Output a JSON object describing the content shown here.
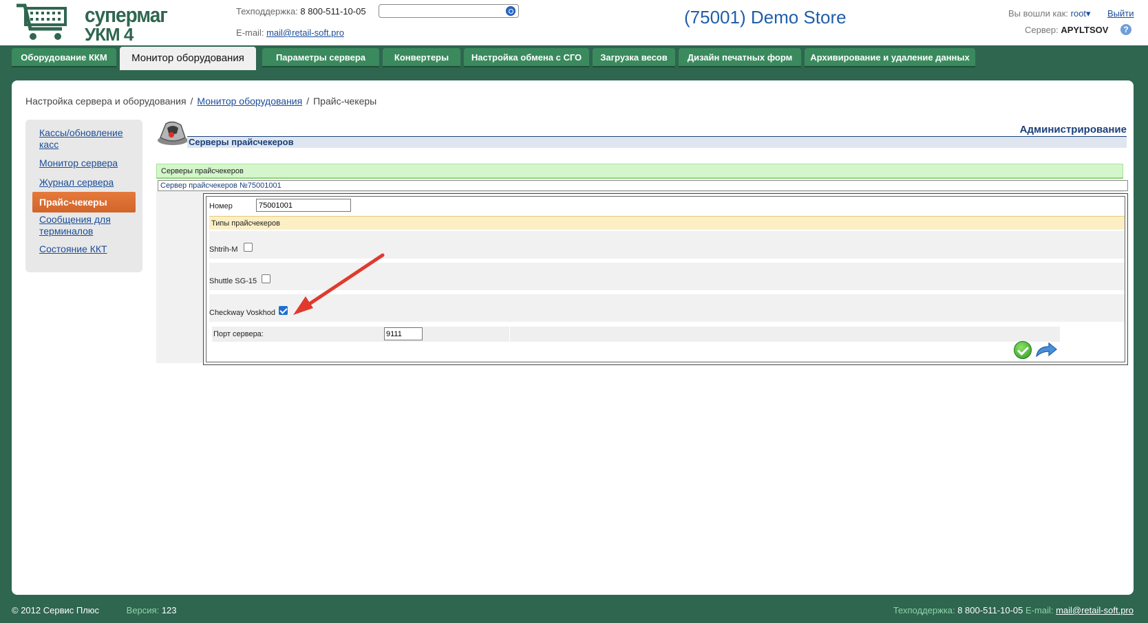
{
  "header": {
    "logo_line1": "супермаг",
    "logo_line2": "УКМ 4",
    "support_label": "Техподдержка:",
    "support_phone": "8 800-511-10-05",
    "email_label": "E-mail:",
    "email_value": "mail@retail-soft.pro",
    "search_value": "",
    "store_title": "(75001) Demo Store",
    "logged_label": "Вы вошли как:",
    "user": "root",
    "logout": "Выйти",
    "server_label": "Сервер:",
    "server_value": "APYLTSOV",
    "help": "?"
  },
  "tabs": [
    {
      "label": "Оборудование ККМ"
    },
    {
      "label": "Монитор оборудования",
      "active": true
    },
    {
      "label": "Параметры сервера"
    },
    {
      "label": "Конвертеры"
    },
    {
      "label": "Настройка обмена с СГО"
    },
    {
      "label": "Загрузка весов"
    },
    {
      "label": "Дизайн печатных форм"
    },
    {
      "label": "Архивирование и удаление данных"
    }
  ],
  "breadcrumb": {
    "item1": "Настройка сервера и оборудования",
    "sep": "/",
    "item2": "Монитор оборудования",
    "item3": "Прайс-чекеры"
  },
  "sidebar": {
    "items": [
      {
        "label": "Кассы/обновление касс"
      },
      {
        "label": "Монитор сервера"
      },
      {
        "label": "Журнал сервера"
      },
      {
        "label": "Прайс-чекеры",
        "active": true
      },
      {
        "label": "Сообщения для терминалов"
      },
      {
        "label": "Состояние ККТ"
      }
    ]
  },
  "content": {
    "admin_title": "Администрирование",
    "section_title": "Серверы прайсчекеров",
    "green_bar": "Серверы прайсчекеров",
    "server_row": "Сервер прайсчекеров №75001001",
    "number_label": "Номер",
    "number_value": "75001001",
    "types_label": "Типы прайсчекеров",
    "types": [
      {
        "label": "Shtrih-M",
        "checked": false
      },
      {
        "label": "Shuttle SG-15",
        "checked": false
      },
      {
        "label": "Checkway Voskhod",
        "checked": true
      }
    ],
    "port_label": "Порт сервера:",
    "port_value": "9111"
  },
  "footer": {
    "copyright": "© 2012 Сервис Плюс",
    "version_label": "Версия:",
    "version_value": "123",
    "support_label": "Техподдержка:",
    "support_phone": "8 800-511-10-05",
    "email_label": "E-mail:",
    "email_value": "mail@retail-soft.pro"
  },
  "colors": {
    "brand_green": "#2f6650",
    "tab_green": "#3a8a5e",
    "active_nav": "#e57a3c",
    "link_blue": "#1a4d99",
    "annotation_red": "#e03a2f"
  }
}
